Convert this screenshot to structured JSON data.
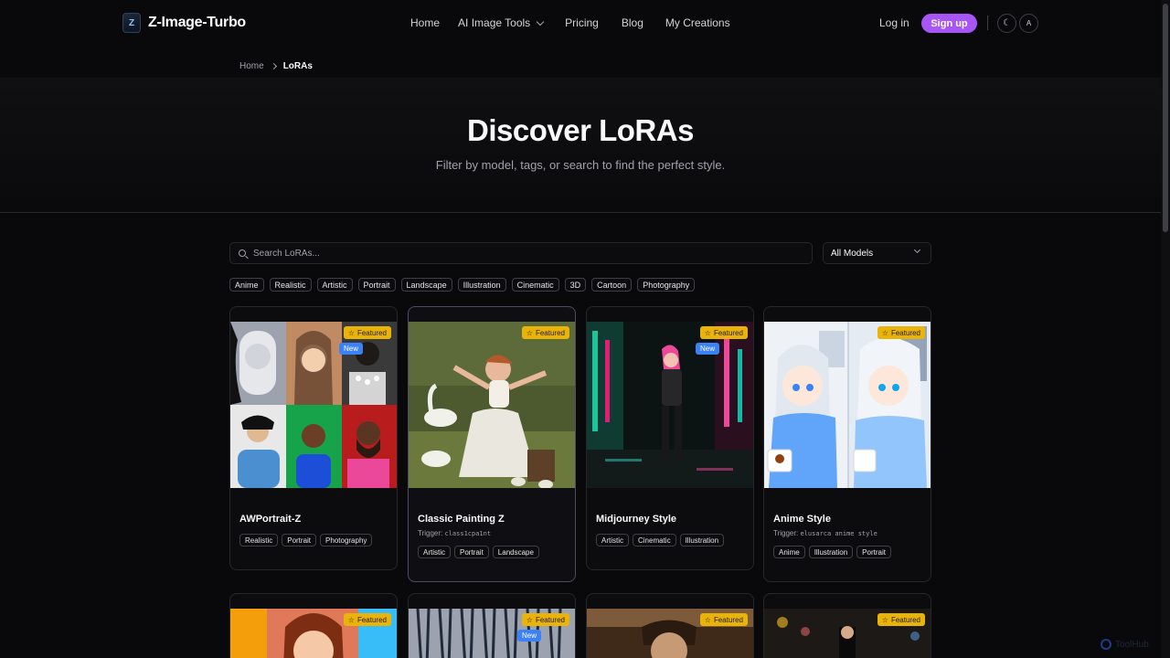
{
  "brand": {
    "name": "Z-Image-Turbo",
    "logo_glyph": "Z"
  },
  "nav": {
    "home": "Home",
    "tools": "AI Image Tools",
    "pricing": "Pricing",
    "blog": "Blog",
    "creations": "My Creations",
    "login": "Log in",
    "signup": "Sign up",
    "theme_glyph": "☾",
    "lang_glyph": "A"
  },
  "breadcrumb": {
    "home": "Home",
    "current": "LoRAs"
  },
  "hero": {
    "title": "Discover LoRAs",
    "subtitle": "Filter by model, tags, or search to find the perfect style."
  },
  "search": {
    "placeholder": "Search LoRAs...",
    "model_select": "All Models"
  },
  "filter_tags": [
    "Anime",
    "Realistic",
    "Artistic",
    "Portrait",
    "Landscape",
    "Illustration",
    "Cinematic",
    "3D",
    "Cartoon",
    "Photography"
  ],
  "badges": {
    "featured": "Featured",
    "new": "New",
    "star": "☆"
  },
  "cards": [
    {
      "title": "AWPortrait-Z",
      "trigger_label": "",
      "trigger": "",
      "tags": [
        "Realistic",
        "Portrait",
        "Photography"
      ],
      "featured": true,
      "new": true
    },
    {
      "title": "Classic Painting Z",
      "trigger_label": "Trigger:",
      "trigger": "class1cpa1nt",
      "tags": [
        "Artistic",
        "Portrait",
        "Landscape"
      ],
      "featured": true,
      "new": false
    },
    {
      "title": "Midjourney Style",
      "trigger_label": "",
      "trigger": "",
      "tags": [
        "Artistic",
        "Cinematic",
        "Illustration"
      ],
      "featured": true,
      "new": true
    },
    {
      "title": "Anime Style",
      "trigger_label": "Trigger:",
      "trigger": "elusarca anime style",
      "tags": [
        "Anime",
        "Illustration",
        "Portrait"
      ],
      "featured": true,
      "new": false
    }
  ],
  "row2": [
    {
      "featured": true,
      "new": false
    },
    {
      "featured": true,
      "new": true
    },
    {
      "featured": true,
      "new": false
    },
    {
      "featured": true,
      "new": false
    }
  ],
  "watermark": "ToolHub"
}
